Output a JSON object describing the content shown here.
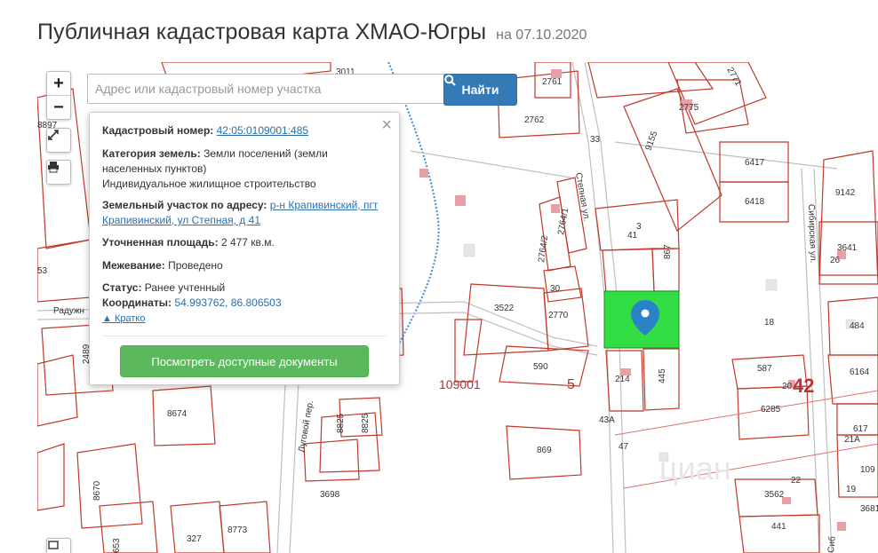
{
  "header": {
    "title": "Публичная кадастровая карта ХМАО-Югры",
    "date": "на 07.10.2020"
  },
  "map": {
    "zoom_in_label": "+",
    "zoom_out_label": "−",
    "labels": {
      "streets": [
        "Степная ул.",
        "Сибирская ул.",
        "Луговой пер.",
        "Радужн",
        "Сиб"
      ],
      "quarter": "109001",
      "district_5": "5",
      "district_42": "42",
      "parcels": [
        "3011",
        "2761",
        "2762",
        "2771",
        "2775",
        "33",
        "9155",
        "6417",
        "6418",
        "9142",
        "3641",
        "26",
        "3",
        "41",
        "867",
        "2764/1",
        "2764/2",
        "30",
        "3522",
        "2770",
        "18",
        "484",
        "6164",
        "590",
        "214",
        "445",
        "587",
        "20",
        "6285",
        "617",
        "21A",
        "109",
        "19",
        "3681",
        "43A",
        "47",
        "869",
        "3562",
        "22",
        "441",
        "8897",
        "53",
        "2489",
        "8674",
        "8825",
        "8825",
        "3698",
        "8670",
        "653",
        "327",
        "8773"
      ]
    },
    "watermark": "циан"
  },
  "search": {
    "placeholder": "Адрес или кадастровый номер участка",
    "button_label": "Найти"
  },
  "popup": {
    "close_label": "×",
    "cadastral_label": "Кадастровый номер:",
    "cadastral_value": "42:05:0109001:485",
    "category_label": "Категория земель:",
    "category_value": "Земли поселений (земли населенных пунктов)",
    "usage_value": "Индивидуальное жилищное строительство",
    "address_label": "Земельный участок по адресу:",
    "address_value": "р-н Крапивинский, пгт Крапивинский, ул Степная, д 41",
    "area_label": "Уточненная площадь:",
    "area_value": "2 477 кв.м.",
    "survey_label": "Межевание:",
    "survey_value": "Проведено",
    "status_label": "Статус:",
    "status_value": "Ранее учтенный",
    "coords_label": "Координаты:",
    "coords_value": "54.993762, 86.806503",
    "collapse_label": "Кратко",
    "docs_button": "Посмотреть доступные документы"
  },
  "colors": {
    "parcel_line": "#c0392b",
    "selected_parcel": "#33dd44",
    "marker": "#2a82c9",
    "search_button": "#337ab7",
    "docs_button": "#5cb85c"
  }
}
